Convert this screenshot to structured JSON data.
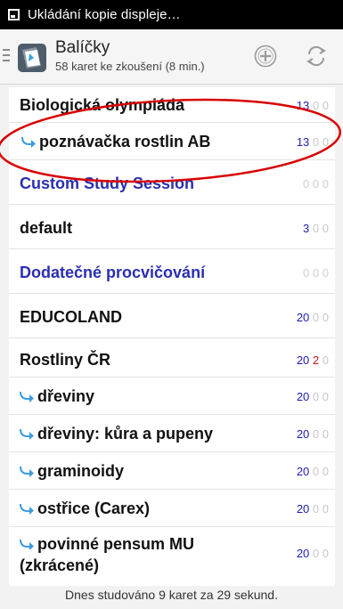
{
  "statusbar": {
    "text": "Ukládání kopie displeje…"
  },
  "actionbar": {
    "title": "Balíčky",
    "subtitle": "58 karet ke zkoušení (8 min.)"
  },
  "decks": [
    {
      "name": "Biologická olympiáda",
      "new": "13",
      "learn": "0",
      "review": "0",
      "style": "top"
    },
    {
      "name": "poznávačka rostlin AB",
      "new": "13",
      "learn": "0",
      "review": "0",
      "style": "child"
    },
    {
      "name": "Custom Study Session",
      "new": "0",
      "learn": "0",
      "review": "0",
      "style": "filtered"
    },
    {
      "name": "default",
      "new": "3",
      "learn": "0",
      "review": "0",
      "style": "top"
    },
    {
      "name": "Dodatečné procvičování",
      "new": "0",
      "learn": "0",
      "review": "0",
      "style": "filtered"
    },
    {
      "name": "EDUCOLAND",
      "new": "20",
      "learn": "0",
      "review": "0",
      "style": "top"
    },
    {
      "name": "Rostliny ČR",
      "new": "20",
      "learn": "2",
      "review": "0",
      "style": "top"
    },
    {
      "name": "dřeviny",
      "new": "20",
      "learn": "0",
      "review": "0",
      "style": "child"
    },
    {
      "name": "dřeviny: kůra a pupeny",
      "new": "20",
      "learn": "0",
      "review": "0",
      "style": "child"
    },
    {
      "name": "graminoidy",
      "new": "20",
      "learn": "0",
      "review": "0",
      "style": "child"
    },
    {
      "name": "ostřice (Carex)",
      "new": "20",
      "learn": "0",
      "review": "0",
      "style": "child"
    },
    {
      "name_line1": "povinné pensum MU",
      "name_line2": "(zkrácené)",
      "new": "20",
      "learn": "0",
      "review": "0",
      "style": "child"
    }
  ],
  "footer": {
    "text": "Dnes studováno 9 karet za 29 sekund."
  },
  "icons": {
    "app": "deck-app-icon",
    "add": "add-circle-icon",
    "sync": "sync-icon",
    "drawer": "drawer-menu-icon",
    "subdeck": "subdeck-arrow-icon"
  },
  "colors": {
    "new_count": "#1c1cb4",
    "learn_count": "#c01818",
    "zero_count": "#c8c8c8",
    "filtered_deck": "#2a2fb0",
    "annotation": "#d80000"
  }
}
